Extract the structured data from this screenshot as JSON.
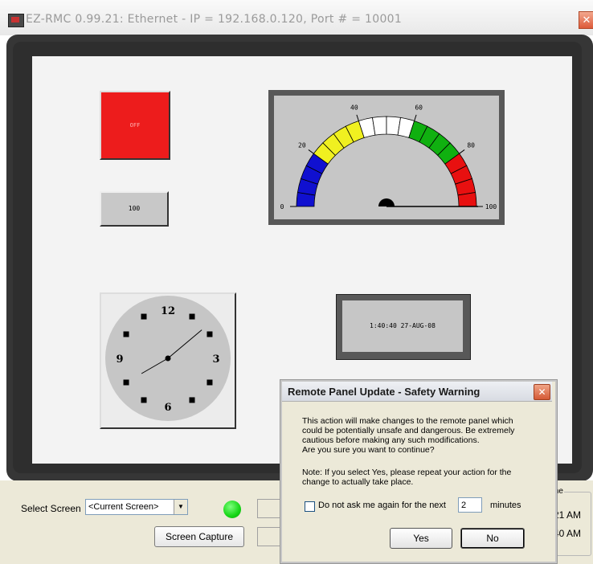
{
  "window": {
    "title": "EZ-RMC 0.99.21: Ethernet - IP = 192.168.0.120, Port # = 10001",
    "close_glyph": "✕"
  },
  "panel": {
    "indicator": {
      "label": "OFF",
      "color": "#ed1c1c"
    },
    "numeric_display": {
      "value": "100"
    },
    "gauge": {
      "min": 0,
      "max": 100,
      "value": 100,
      "tick_labels": [
        "0",
        "20",
        "40",
        "60",
        "80",
        "100"
      ],
      "zones": [
        {
          "from": 0,
          "to": 20,
          "color": "#1010d0"
        },
        {
          "from": 20,
          "to": 40,
          "color": "#f0f020"
        },
        {
          "from": 40,
          "to": 60,
          "color": "#ffffff"
        },
        {
          "from": 60,
          "to": 80,
          "color": "#10b010"
        },
        {
          "from": 80,
          "to": 100,
          "color": "#e81010"
        }
      ]
    },
    "clock": {
      "numbers": [
        "12",
        "3",
        "6",
        "9"
      ],
      "hour": 1,
      "minute": 40
    },
    "datetime": {
      "value": "1:40:40 27-AUG-08"
    }
  },
  "bottom": {
    "select_label": "Select Screen",
    "select_value": "<Current Screen>",
    "select_arrow_icon": "dropdown-arrow-icon",
    "status_led_color": "#16d616",
    "capture_label": "Screen Capture",
    "time_group_label": "me",
    "time_1": "21 AM",
    "time_2": "40 AM"
  },
  "dialog": {
    "title": "Remote Panel Update - Safety Warning",
    "close_glyph": "✕",
    "body": [
      "This action will make changes to the remote panel which",
      "could be potentially unsafe and dangerous. Be extremely",
      "cautious before making any such modifications.",
      "Are you sure you want to continue?"
    ],
    "note": [
      "Note: If you select Yes, please repeat your action for the",
      "change to actually take place."
    ],
    "checkbox_label": "Do not ask me again for the next",
    "checkbox_checked": false,
    "minutes_value": "2",
    "minutes_label": "minutes",
    "yes_label": "Yes",
    "no_label": "No"
  }
}
